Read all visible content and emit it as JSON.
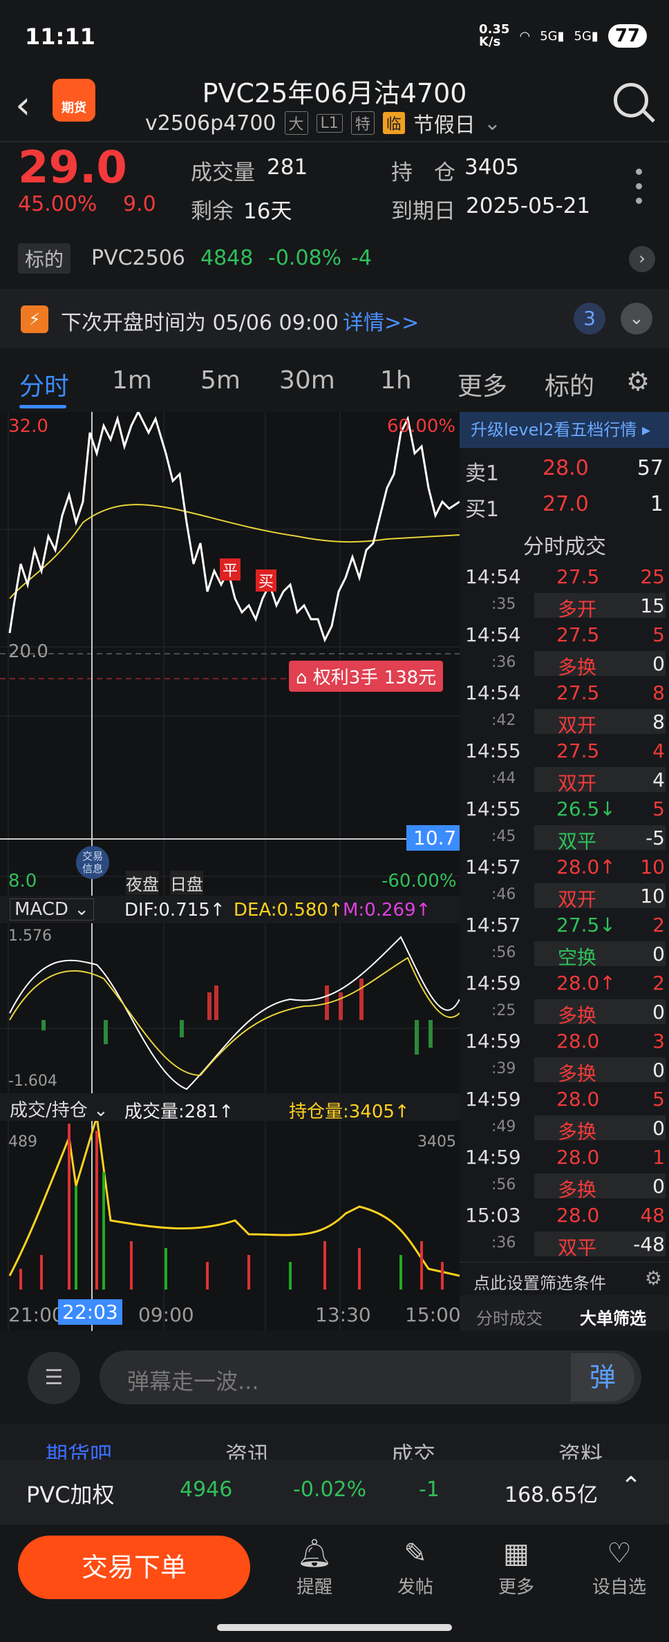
{
  "status": {
    "time": "11:11",
    "speed": "0.35\nK/s",
    "net1": "5G",
    "net2": "5G",
    "battery": "77"
  },
  "header": {
    "title": "PVC25年06月沽4700",
    "code": "v2506p4700",
    "tags": [
      "大",
      "L1",
      "特",
      "临"
    ],
    "holiday": "节假日",
    "logo": "期货"
  },
  "quote": {
    "price": "29.0",
    "pct": "45.00%",
    "chg": "9.0",
    "vol_label": "成交量",
    "vol": "281",
    "oi_label": "持　仓",
    "oi": "3405",
    "remain_label": "剩余",
    "remain": "16天",
    "expiry_label": "到期日",
    "expiry": "2025-05-21"
  },
  "underlying": {
    "label": "标的",
    "name": "PVC2506",
    "price": "4848",
    "pct": "-0.08%",
    "chg": "-4"
  },
  "notice": {
    "text": "下次开盘时间为 05/06 09:00",
    "link": "详情>>",
    "count": "3"
  },
  "tabs": [
    "分时",
    "1m",
    "5m",
    "30m",
    "1h",
    "更多",
    "标的"
  ],
  "chart": {
    "ymax": "32.0",
    "ymin": "8.0",
    "pmax": "60.00%",
    "pmin": "-60.00%",
    "baseline": "20.0",
    "cur": "10.7",
    "trade_label": "权利3手 138元",
    "mark_flat": "平",
    "mark_buy": "买",
    "info_btn": "交易\n信息",
    "session_night": "夜盘",
    "session_day": "日盘",
    "macd_label": "MACD",
    "dif": "DIF:0.715↑",
    "dea": "DEA:0.580↑",
    "m": "M:0.269↑",
    "macd_max": "1.576",
    "macd_min": "-1.604",
    "vol_label": "成交/持仓",
    "vol_text": "成交量:281↑",
    "oi_text": "持仓量:3405↑",
    "vol_max": "489",
    "oi_max": "3405",
    "times": [
      "21:00",
      "22:03",
      "09:00",
      "13:30",
      "15:00"
    ]
  },
  "panel": {
    "level2": "升级level2看五档行情",
    "ask": {
      "label": "卖1",
      "price": "28.0",
      "vol": "57"
    },
    "bid": {
      "label": "买1",
      "price": "27.0",
      "vol": "1"
    },
    "ticks_title": "分时成交",
    "ticks": [
      {
        "t": "14:54",
        "s": ":35",
        "p": "27.5",
        "pc": "red",
        "v": "25",
        "tp": "多开",
        "tc": "red",
        "d": "15"
      },
      {
        "t": "14:54",
        "s": ":36",
        "p": "27.5",
        "pc": "red",
        "v": "5",
        "tp": "多换",
        "tc": "red",
        "d": "0"
      },
      {
        "t": "14:54",
        "s": ":42",
        "p": "27.5",
        "pc": "red",
        "v": "8",
        "tp": "双开",
        "tc": "red",
        "d": "8"
      },
      {
        "t": "14:55",
        "s": ":44",
        "p": "27.5",
        "pc": "red",
        "v": "4",
        "tp": "双开",
        "tc": "red",
        "d": "4"
      },
      {
        "t": "14:55",
        "s": ":45",
        "p": "26.5↓",
        "pc": "green",
        "v": "5",
        "tp": "双平",
        "tc": "green",
        "d": "-5"
      },
      {
        "t": "14:57",
        "s": ":46",
        "p": "28.0↑",
        "pc": "red",
        "v": "10",
        "tp": "双开",
        "tc": "red",
        "d": "10"
      },
      {
        "t": "14:57",
        "s": ":56",
        "p": "27.5↓",
        "pc": "green",
        "v": "2",
        "tp": "空换",
        "tc": "green",
        "d": "0"
      },
      {
        "t": "14:59",
        "s": ":25",
        "p": "28.0↑",
        "pc": "red",
        "v": "2",
        "tp": "多换",
        "tc": "red",
        "d": "0"
      },
      {
        "t": "14:59",
        "s": ":39",
        "p": "28.0",
        "pc": "red",
        "v": "3",
        "tp": "多换",
        "tc": "red",
        "d": "0"
      },
      {
        "t": "14:59",
        "s": ":49",
        "p": "28.0",
        "pc": "red",
        "v": "5",
        "tp": "多换",
        "tc": "red",
        "d": "0"
      },
      {
        "t": "14:59",
        "s": ":56",
        "p": "28.0",
        "pc": "red",
        "v": "1",
        "tp": "多换",
        "tc": "red",
        "d": "0"
      },
      {
        "t": "15:03",
        "s": ":36",
        "p": "28.0",
        "pc": "red",
        "v": "48",
        "tp": "双平",
        "tc": "red",
        "d": "-48"
      }
    ],
    "filter": "点此设置筛选条件",
    "tab1": "分时成交",
    "tab2": "大单筛选"
  },
  "danmu": {
    "placeholder": "弹幕走一波...",
    "send": "弹"
  },
  "subtabs": [
    "期货吧",
    "资讯",
    "成交",
    "资料"
  ],
  "info": {
    "name": "PVC加权",
    "price": "4946",
    "pct": "-0.02%",
    "chg": "-1",
    "amount": "168.65亿"
  },
  "nav": {
    "trade": "交易下单",
    "items": [
      "提醒",
      "发帖",
      "更多",
      "设自选"
    ]
  }
}
